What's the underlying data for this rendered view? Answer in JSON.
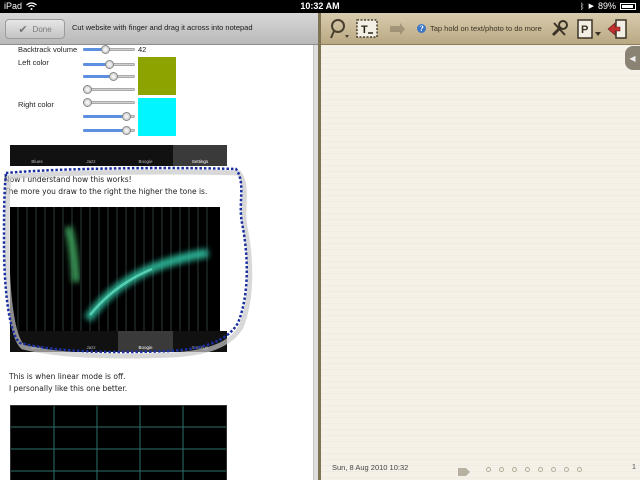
{
  "status_bar": {
    "device": "iPad",
    "time": "10:32 AM",
    "battery": "89%",
    "battery_fraction": 0.89
  },
  "left_toolbar": {
    "done_label": "Done",
    "hint": "Cut website with finger and drag it across into notepad"
  },
  "web_content": {
    "backtrack_label": "Backtrack volume",
    "backtrack_value": "42",
    "backtrack_fraction": 0.42,
    "left_color_label": "Left color",
    "left_color_sliders": [
      0.5,
      0.6,
      0.0
    ],
    "left_color_hex": "#8da300",
    "right_color_label": "Right color",
    "right_color_sliders": [
      0.0,
      0.9,
      0.9
    ],
    "right_color_hex": "#00f5ff",
    "tabs": [
      "Blues",
      "Jazz",
      "Boogie",
      "Settings"
    ],
    "tabs_top_selected": "Settings",
    "tabs_bottom_selected": "Boogie",
    "para1_line1": "Now I understand how this works!",
    "para1_line2": "The more you draw to the right the higher the tone is.",
    "para2_line1": "This is when linear mode is off.",
    "para2_line2": "I personally like this one better.",
    "selection_color": "#1a2fa0"
  },
  "right_toolbar": {
    "icons": [
      "lasso-icon",
      "text-tool-icon",
      "redo-icon",
      "settings-tools-icon",
      "page-export-icon",
      "exit-icon"
    ],
    "hint": "Tap hold on text/photo to do more"
  },
  "notepad": {
    "date": "Sun, 8 Aug 2010 10:32",
    "page_number": "1",
    "page_dots": 8
  }
}
